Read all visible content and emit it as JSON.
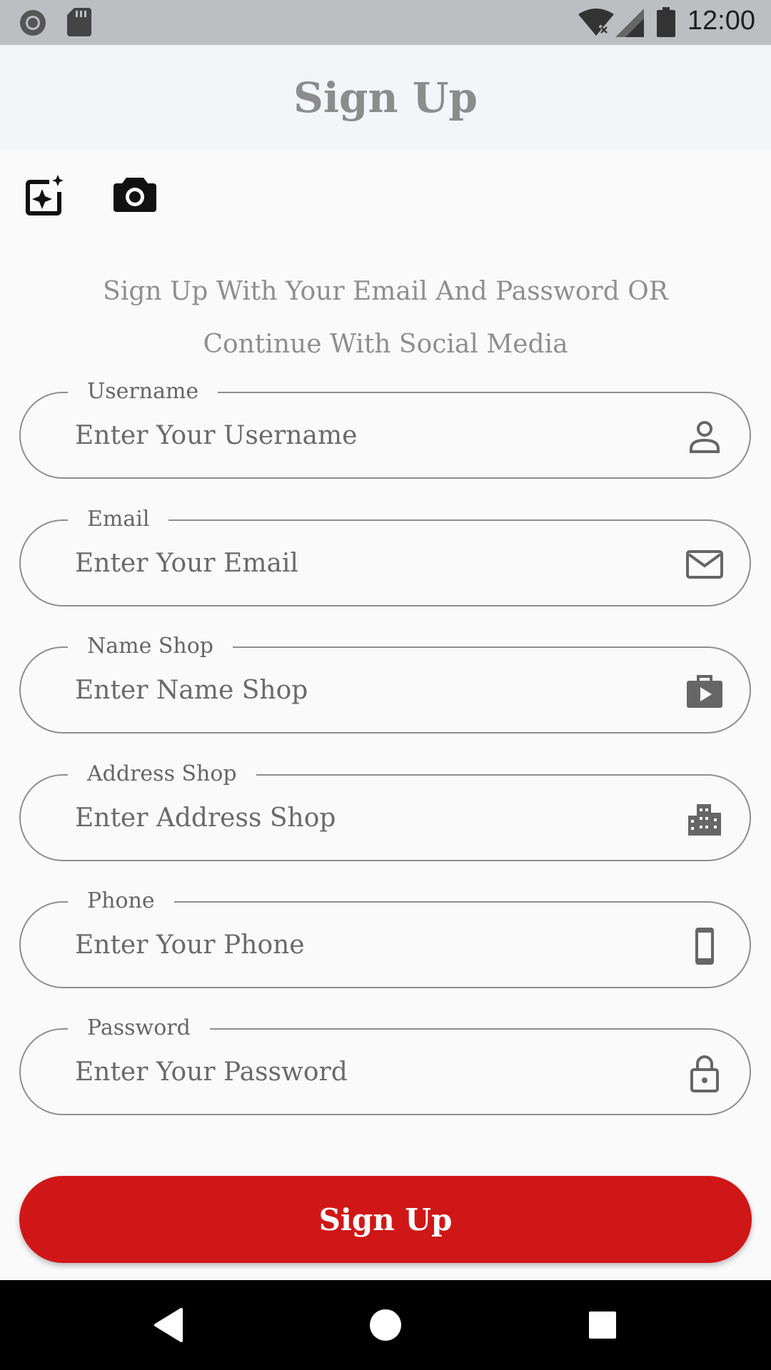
{
  "status_bar": {
    "time": "12:00",
    "icons": [
      "notification-dot-icon",
      "sd-card-icon",
      "wifi-off-icon",
      "signal-icon",
      "battery-icon"
    ]
  },
  "app_bar": {
    "title": "Sign Up"
  },
  "toolbar": {
    "icons": [
      "image-sparkle-icon",
      "camera-icon"
    ]
  },
  "subtitle": "Sign Up With Your Email And Password OR Continue With Social Media",
  "fields": [
    {
      "label": "Username",
      "placeholder": "Enter Your Username",
      "icon": "person-icon"
    },
    {
      "label": "Email",
      "placeholder": "Enter Your Email",
      "icon": "mail-icon"
    },
    {
      "label": "Name Shop",
      "placeholder": "Enter Name Shop",
      "icon": "shop-bag-icon"
    },
    {
      "label": "Address Shop",
      "placeholder": "Enter Address Shop",
      "icon": "building-icon"
    },
    {
      "label": "Phone",
      "placeholder": "Enter Your Phone",
      "icon": "phone-icon"
    },
    {
      "label": "Password",
      "placeholder": "Enter Your Password",
      "icon": "lock-icon"
    }
  ],
  "signup_button": {
    "label": "Sign Up",
    "color": "#d01717"
  },
  "nav_bar": {
    "icons": [
      "back-icon",
      "home-icon",
      "recents-icon"
    ]
  }
}
